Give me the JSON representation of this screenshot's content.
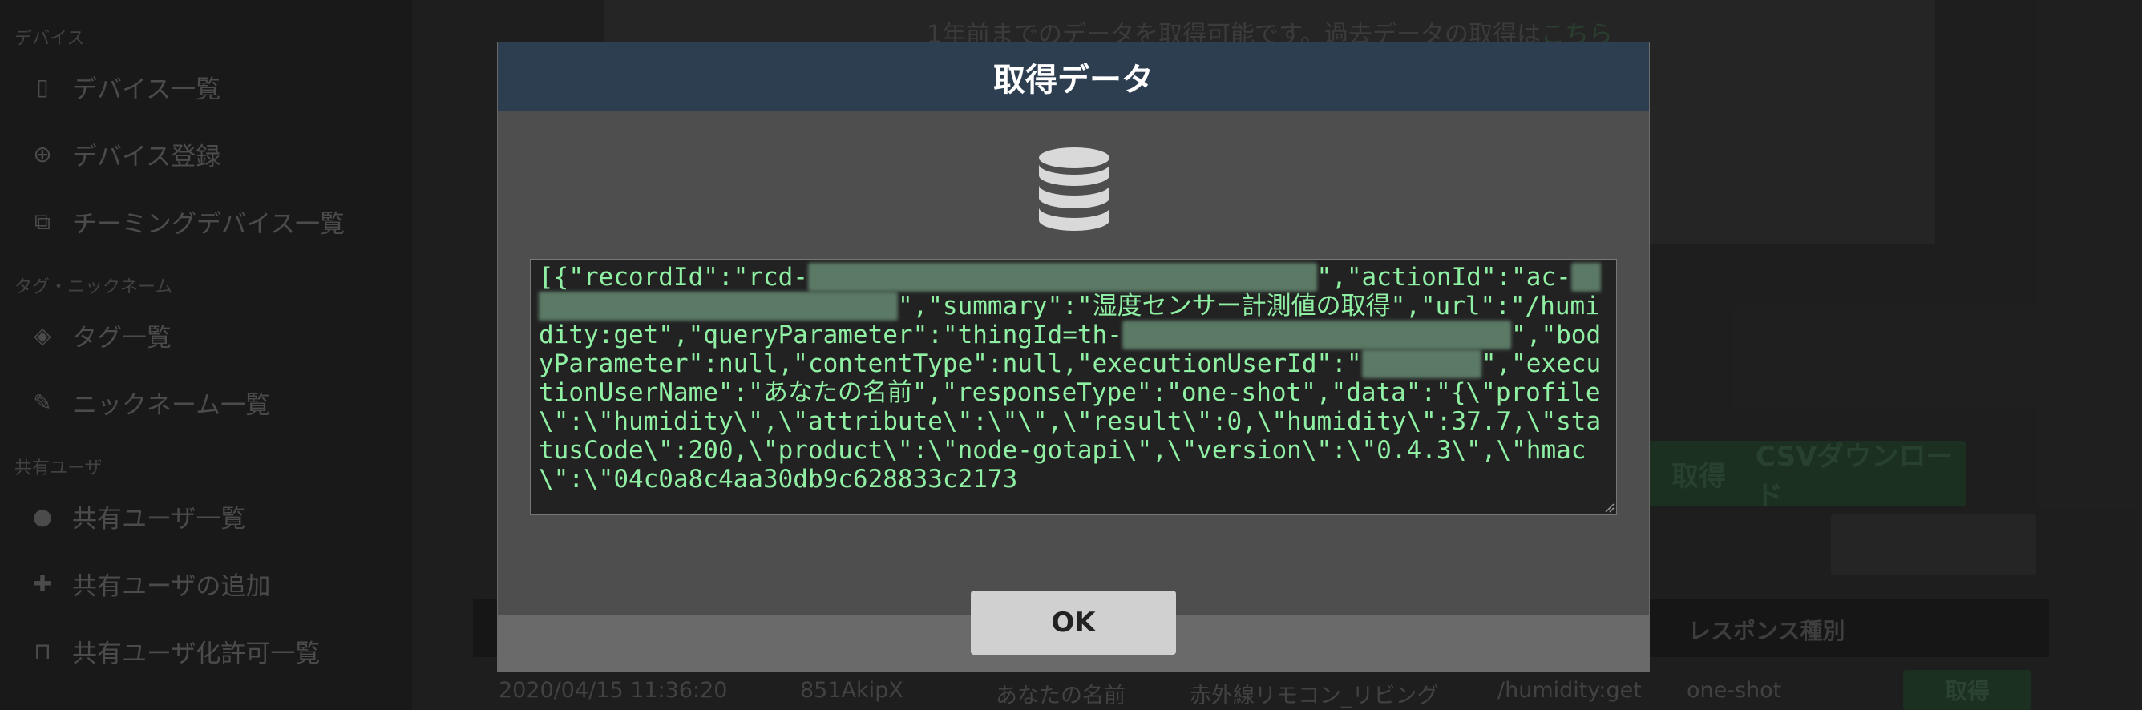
{
  "sidebar": {
    "sections": [
      {
        "label": "デバイス",
        "items": [
          {
            "label": "デバイス一覧",
            "icon": "mobile-icon"
          },
          {
            "label": "デバイス登録",
            "icon": "plus-circle-icon"
          },
          {
            "label": "チーミングデバイス一覧",
            "icon": "clone-icon"
          }
        ]
      },
      {
        "label": "タグ・ニックネーム",
        "items": [
          {
            "label": "タグ一覧",
            "icon": "tags-icon"
          },
          {
            "label": "ニックネーム一覧",
            "icon": "pencil-icon"
          }
        ]
      },
      {
        "label": "共有ユーザ",
        "items": [
          {
            "label": "共有ユーザ一覧",
            "icon": "user-icon"
          },
          {
            "label": "共有ユーザの追加",
            "icon": "user-plus-icon"
          },
          {
            "label": "共有ユーザ化許可一覧",
            "icon": "unlock-icon"
          }
        ]
      }
    ]
  },
  "background": {
    "notice_text": "1年前までのデータを取得可能です。過去データの取得は",
    "notice_link": "こちら",
    "get_button": "取得",
    "csv_button": "CSVダウンロード",
    "table_header_response_type": "レスポンス種別",
    "row": {
      "datetime": "2020/04/15 11:36:20",
      "user_id": "851AkipX",
      "user_name": "あなたの名前",
      "device": "赤外線リモコン_リビング",
      "url": "/humidity:get",
      "response_type": "one-shot",
      "action": "取得"
    }
  },
  "modal": {
    "title": "取得データ",
    "icon": "database-icon",
    "ok_label": "OK",
    "data_parts": {
      "p1": "[{\"recordId\":\"rcd-",
      "p2": "\",\"actionId\":\"ac-",
      "p3": "\",\"summary\":\"湿度センサー計測値の取得\",\"url\":\"/humidity:get\",\"queryParameter\":\"thingId=th-",
      "p4": "\",\"bodyParameter\":null,\"contentType\":null,\"executionUserId\":\"",
      "p5": "\",\"executionUserName\":\"あなたの名前\",\"responseType\":\"one-shot\",\"data\":\"{\\\"profile\\\":\\\"humidity\\\",\\\"attribute\\\":\\\"\\\",\\\"result\\\":0,\\\"humidity\\\":37.7,\\\"statusCode\\\":200,\\\"product\\\":\\\"node-gotapi\\\",\\\"version\\\":\\\"0.4.3\\\",\\\"hmac\\\":\\\"04c0a8c4aa30db9c628833c2173"
    }
  },
  "colors": {
    "modal_header": "#2d3e50",
    "data_text": "#8ff0a4",
    "button_green": "#27452f"
  }
}
